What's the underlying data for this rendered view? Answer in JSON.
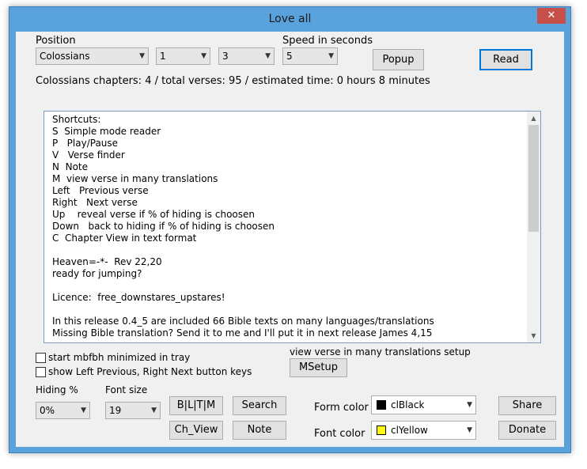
{
  "window": {
    "title": "Love all",
    "close_glyph": "✕"
  },
  "position": {
    "label": "Position",
    "book": "Colossians",
    "chapter": "1",
    "verse": "3"
  },
  "speed": {
    "label": "Speed in seconds",
    "value": "5"
  },
  "buttons": {
    "popup": "Popup",
    "read": "Read",
    "msetup": "MSetup",
    "bitm": "B|L|T|M",
    "search": "Search",
    "ch_view": "Ch_View",
    "note": "Note",
    "share": "Share",
    "donate": "Donate"
  },
  "info_line": "Colossians chapters: 4 / total verses: 95 / estimated time: 0 hours 8 minutes",
  "memo_lines": [
    "Shortcuts:",
    "S  Simple mode reader",
    "P   Play/Pause",
    "V   Verse finder",
    "N  Note",
    "M  view verse in many translations",
    "Left   Previous verse",
    "Right   Next verse",
    "Up    reveal verse if % of hiding is choosen",
    "Down   back to hiding if % of hiding is choosen",
    "C  Chapter View in text format",
    "",
    "Heaven=-*-  Rev 22,20",
    "ready for jumping?",
    "",
    "Licence:  free_downstares_upstares!",
    "",
    "In this release 0.4_5 are included 66 Bible texts on many languages/translations",
    "Missing Bible translation? Send it to me and I'll put it in next release James 4,15"
  ],
  "options": {
    "minimized": "start mbfbh minimized in tray",
    "show_keys": "show Left Previous, Right Next button keys",
    "translations_setup": "view verse in many translations setup"
  },
  "hiding": {
    "label": "Hiding %",
    "value": "0%"
  },
  "font_size": {
    "label": "Font size",
    "value": "19"
  },
  "form_color": {
    "label": "Form color",
    "value": "clBlack",
    "swatch": "#000000"
  },
  "font_color": {
    "label": "Font color",
    "value": "clYellow",
    "swatch": "#ffff00"
  },
  "colors": {
    "titlebar": "#5aa2dc",
    "close": "#c7504a",
    "focus": "#0078d7"
  }
}
